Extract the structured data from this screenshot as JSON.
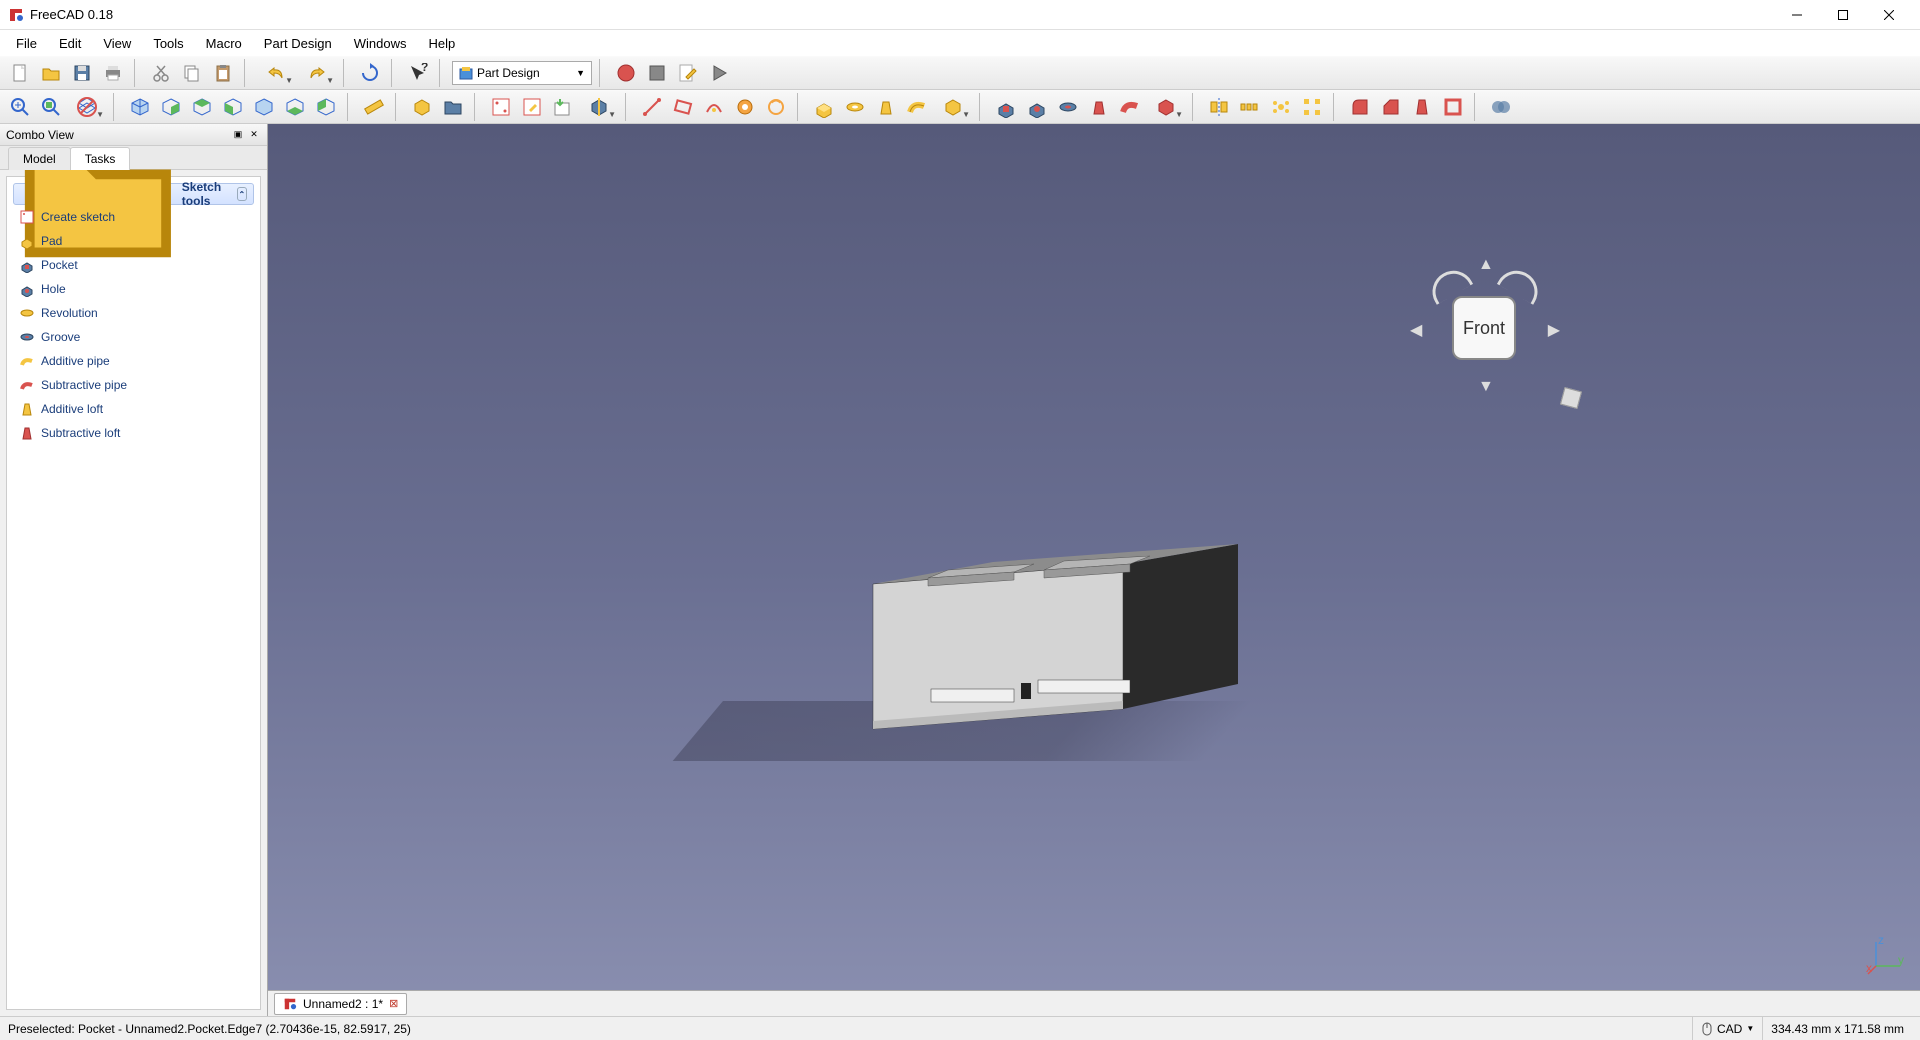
{
  "app": {
    "title": "FreeCAD 0.18"
  },
  "menu": [
    "File",
    "Edit",
    "View",
    "Tools",
    "Macro",
    "Part Design",
    "Windows",
    "Help"
  ],
  "workbench": {
    "selected": "Part Design"
  },
  "combo_view": {
    "title": "Combo View",
    "tabs": {
      "model": "Model",
      "tasks": "Tasks"
    },
    "group": "Sketch tools",
    "items": [
      "Create sketch",
      "Pad",
      "Pocket",
      "Hole",
      "Revolution",
      "Groove",
      "Additive pipe",
      "Subtractive pipe",
      "Additive loft",
      "Subtractive loft"
    ]
  },
  "navcube": {
    "face": "Front"
  },
  "doc_tab": {
    "label": "Unnamed2 : 1*"
  },
  "status": {
    "preselected": "Preselected: Pocket - Unnamed2.Pocket.Edge7 (2.70436e-15, 82.5917, 25)",
    "navstyle": "CAD",
    "dimensions": "334.43 mm x 171.58 mm"
  },
  "axes": {
    "x": "x",
    "y": "y",
    "z": "z"
  }
}
